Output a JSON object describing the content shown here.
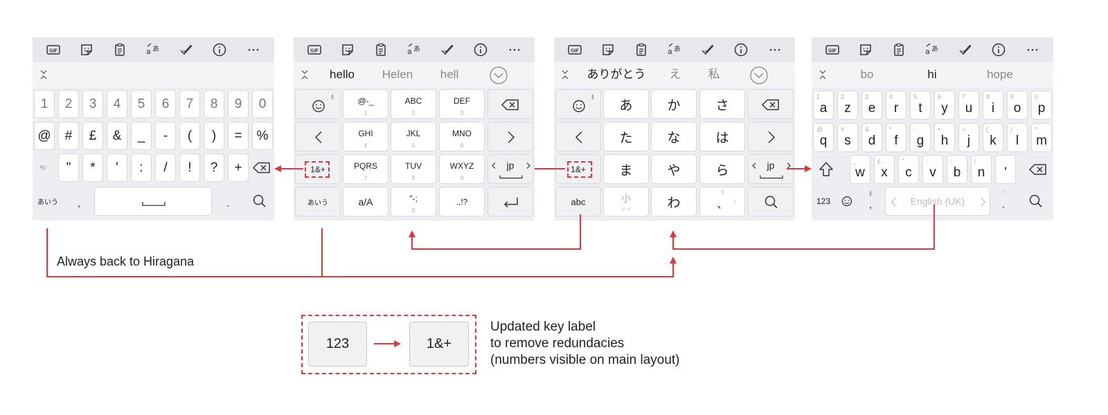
{
  "annotations": {
    "back_to_hiragana": "Always back to Hiragana",
    "legend_from": "123",
    "legend_to": "1&+",
    "legend_lines": [
      "Updated key label",
      "to remove redundacies",
      "(numbers visible on main layout)"
    ]
  },
  "keyboards": {
    "symbols": {
      "row1": [
        "1",
        "2",
        "3",
        "4",
        "5",
        "6",
        "7",
        "8",
        "9",
        "0"
      ],
      "row2": [
        "@",
        "#",
        "£",
        "&",
        "_",
        "-",
        "(",
        ")",
        "=",
        "%"
      ],
      "row3": [
        "\"",
        "*",
        "'",
        ":",
        "/",
        "!",
        "?",
        "+"
      ],
      "row3_left": "%⁻",
      "bottom_left": "あいう",
      "bottom_comma": ",",
      "bottom_period": "."
    },
    "t9_latin": {
      "suggestions": [
        "hello",
        "Helen",
        "hell"
      ],
      "row1": [
        {
          "lbl": "@-_",
          "sub": "1"
        },
        {
          "lbl": "ABC",
          "sub": "2"
        },
        {
          "lbl": "DEF",
          "sub": "3"
        }
      ],
      "row2": [
        {
          "lbl": "GHI",
          "sub": "4"
        },
        {
          "lbl": "JKL",
          "sub": "5"
        },
        {
          "lbl": "MNO",
          "sub": "6"
        }
      ],
      "row3": [
        {
          "lbl": "PQRS",
          "sub": "7"
        },
        {
          "lbl": "TUV",
          "sub": "8"
        },
        {
          "lbl": "WXYZ",
          "sub": "9"
        }
      ],
      "row4": [
        {
          "lbl": "a/A",
          "sub": ""
        },
        {
          "lbl": "\"-;",
          "sub": "0"
        },
        {
          "lbl": ".,!?",
          "sub": ""
        }
      ],
      "symbols_key": "1&+",
      "kana_key": "あいう",
      "lang_label": "jp"
    },
    "t9_kana": {
      "suggestions": [
        "ありがとう",
        "え",
        "私"
      ],
      "row1": [
        "あ",
        "か",
        "さ"
      ],
      "row2": [
        "た",
        "な",
        "は"
      ],
      "row3": [
        "ま",
        "や",
        "ら"
      ],
      "row4_mid": "わ",
      "small_key": "小",
      "small_sub": "♂♂",
      "punct_top": "?",
      "punct_mid": "、",
      "punct_right": "!",
      "symbols_key": "1&+",
      "abc_key": "abc",
      "lang_label": "jp"
    },
    "qwerty": {
      "suggestions": [
        "bo",
        "hi",
        "hope"
      ],
      "row1": [
        {
          "k": "a",
          "h": "1"
        },
        {
          "k": "z",
          "h": "2"
        },
        {
          "k": "e",
          "h": "3"
        },
        {
          "k": "r",
          "h": "4"
        },
        {
          "k": "t",
          "h": "5"
        },
        {
          "k": "y",
          "h": "6"
        },
        {
          "k": "u",
          "h": "7"
        },
        {
          "k": "i",
          "h": "8"
        },
        {
          "k": "o",
          "h": "9"
        },
        {
          "k": "p",
          "h": "0"
        }
      ],
      "row2": [
        {
          "k": "q",
          "h": "@"
        },
        {
          "k": "s",
          "h": "#"
        },
        {
          "k": "d",
          "h": "&"
        },
        {
          "k": "f",
          "h": "*"
        },
        {
          "k": "g",
          "h": "-"
        },
        {
          "k": "h",
          "h": "+"
        },
        {
          "k": "j",
          "h": "="
        },
        {
          "k": "k",
          "h": "("
        },
        {
          "k": "l",
          "h": ")"
        },
        {
          "k": "m",
          "h": "^"
        }
      ],
      "row3": [
        {
          "k": "w",
          "h": "_"
        },
        {
          "k": "x",
          "h": "£"
        },
        {
          "k": "c",
          "h": "\""
        },
        {
          "k": "v",
          "h": ":"
        },
        {
          "k": "b",
          "h": ";"
        },
        {
          "k": "n",
          "h": "/"
        },
        {
          "k": "'",
          "h": ""
        }
      ],
      "bottom_123": "123",
      "bottom_comma": ",",
      "space_label": "English (UK)",
      "bottom_period": ".",
      "period_hint": "?!"
    }
  }
}
